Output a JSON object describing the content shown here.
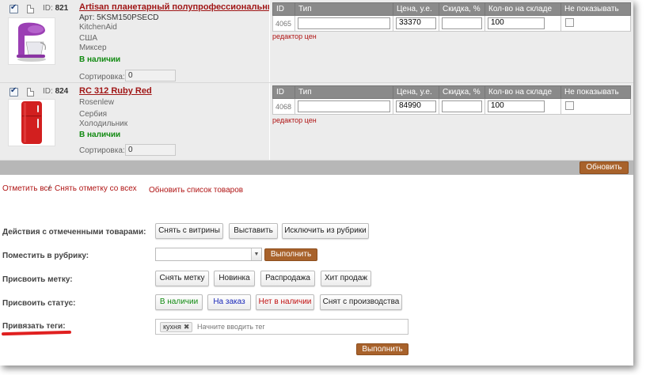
{
  "products": [
    {
      "id_label": "ID:",
      "id": "821",
      "name": "Artisan планетарный полупрофессиональный",
      "sku": "Арт: 5KSM150PSECD",
      "brand": "KitchenAid",
      "country": "США",
      "category": "Миксер",
      "status": "В наличии",
      "sort_label": "Сортировка:",
      "sort_value": "0",
      "row_id": "4065",
      "type_value": "",
      "price": "33370",
      "discount": "",
      "stock": "100",
      "price_editor": "редактор цен",
      "color": "#9b3fb4"
    },
    {
      "id_label": "ID:",
      "id": "824",
      "name": "RC 312 Ruby Red",
      "sku": "",
      "brand": "Rosenlew",
      "country": "Сербия",
      "category": "Холодильник",
      "status": "В наличии",
      "sort_label": "Сортировка:",
      "sort_value": "0",
      "row_id": "4068",
      "type_value": "",
      "price": "84990",
      "discount": "",
      "stock": "100",
      "price_editor": "редактор цен",
      "color": "#d21f1f"
    }
  ],
  "table_headers": [
    "ID",
    "Тип",
    "Цена, у.е.",
    "Скидка, %",
    "Кол-во на складе",
    "Не показывать"
  ],
  "update_button": "Обновить",
  "links": {
    "check_all": "Отметить все",
    "separator": "/",
    "uncheck_all": "Снять отметку со всех",
    "refresh_list": "Обновить список товаров"
  },
  "actions": {
    "checked_label": "Действия с отмеченными товарами:",
    "checked_buttons": [
      "Снять с витрины",
      "Выставить",
      "Исключить из рубрики"
    ],
    "rubric_label": "Поместить в рубрику:",
    "rubric_value": "",
    "execute": "Выполнить",
    "mark_label": "Присвоить метку:",
    "mark_buttons": [
      "Снять метку",
      "Новинка",
      "Распродажа",
      "Хит продаж"
    ],
    "status_label": "Присвоить статус:",
    "status_buttons": [
      "В наличии",
      "На заказ",
      "Нет в наличии",
      "Снят с производства"
    ],
    "tags_label": "Привязать теги:",
    "tag_chip": "кухня",
    "tag_remove": "✖",
    "tags_placeholder": "Начните вводить тег"
  },
  "colors": {
    "accent_brown": "#a8622b",
    "link_red": "#b01414",
    "in_stock_green": "#118a11",
    "header_gray": "#8a8a8a"
  }
}
